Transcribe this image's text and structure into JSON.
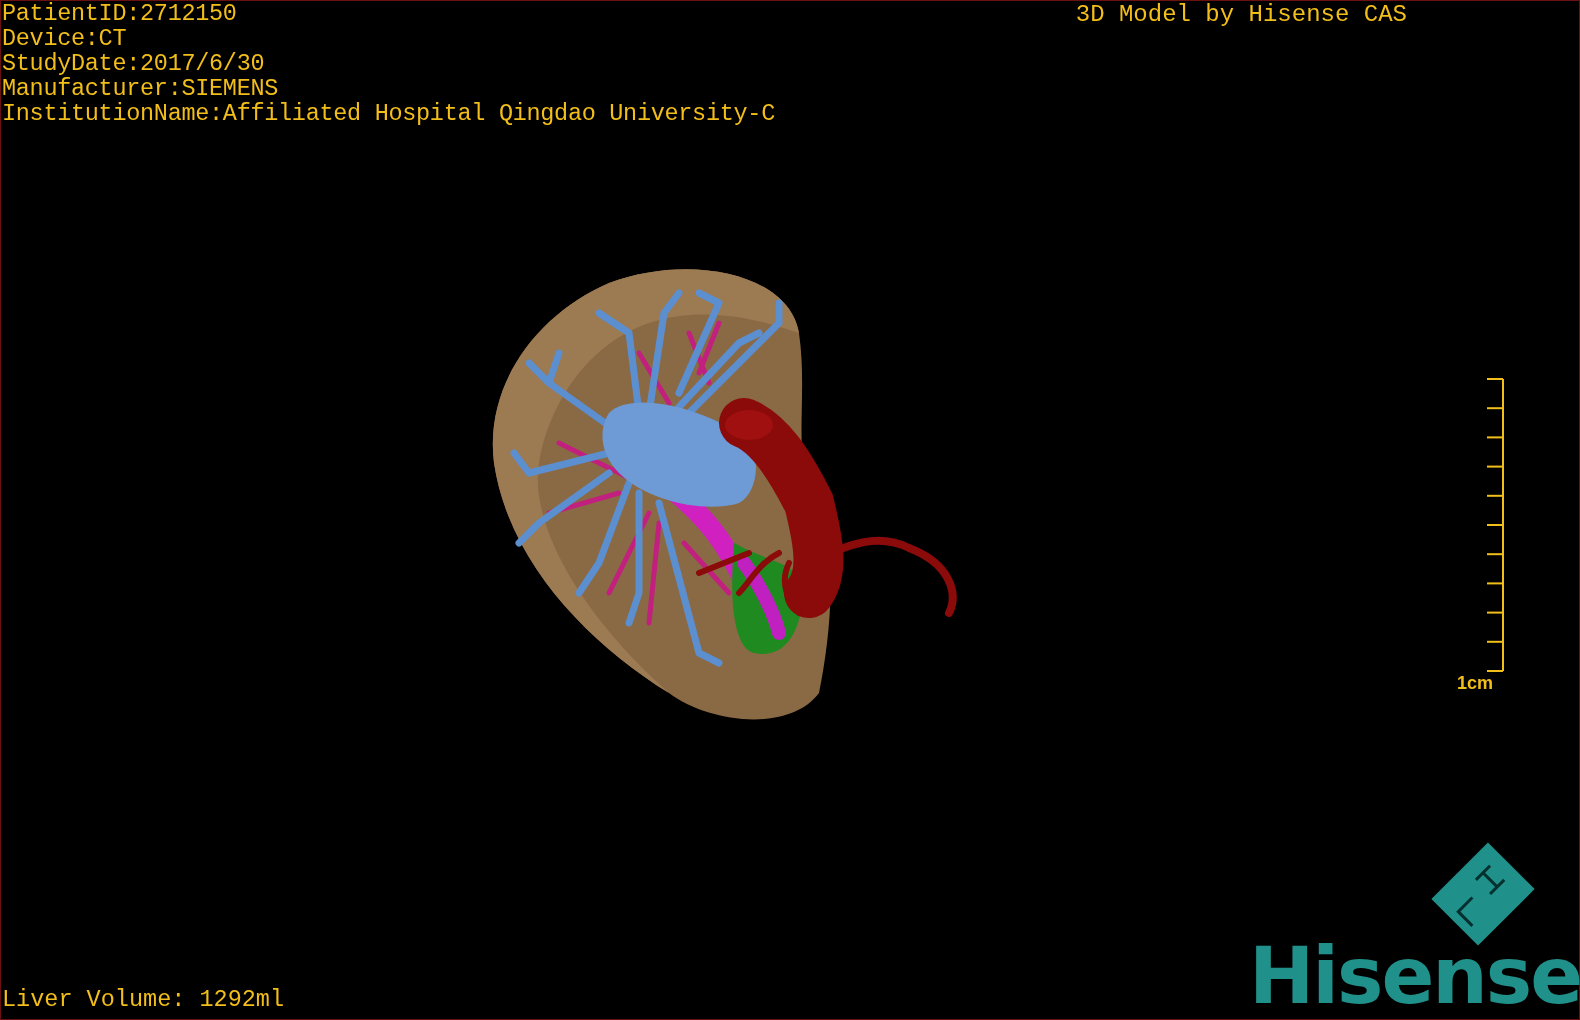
{
  "study_info": [
    "PatientID:2712150",
    "Device:CT",
    "StudyDate:2017/6/30",
    "Manufacturer:SIEMENS",
    "InstitutionName:Affiliated Hospital Qingdao University-C"
  ],
  "model_credit": "3D Model by Hisense CAS",
  "scale_bar": {
    "label": "1cm"
  },
  "liver_volume": "Liver Volume: 1292ml",
  "logo": {
    "wordmark": "Hisense"
  }
}
